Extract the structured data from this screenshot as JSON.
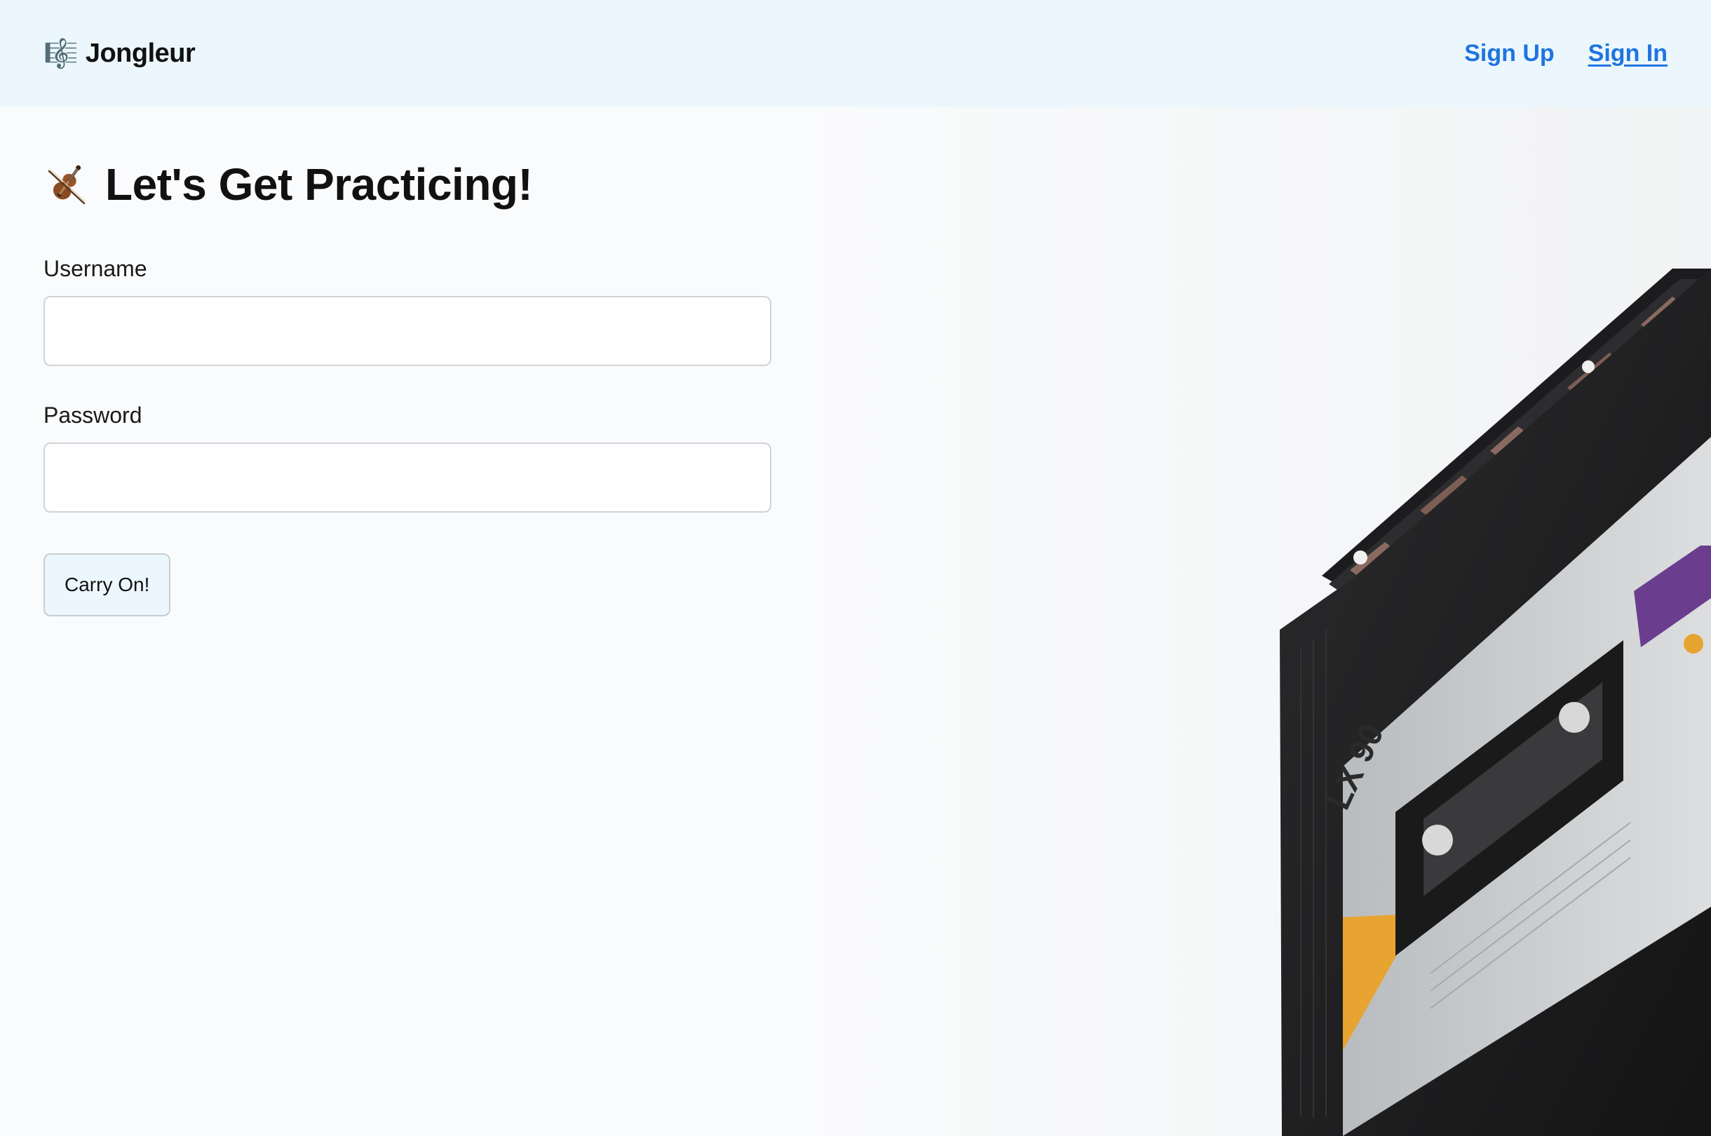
{
  "header": {
    "brand_icon": "🎼",
    "brand_name": "Jongleur",
    "nav": [
      {
        "label": "Sign Up",
        "active": false
      },
      {
        "label": "Sign In",
        "active": true
      }
    ]
  },
  "main": {
    "heading_icon": "violin-icon",
    "heading": "Let's Get Practicing!",
    "username_label": "Username",
    "username_value": "",
    "password_label": "Password",
    "password_value": "",
    "submit_label": "Carry On!"
  },
  "photo": {
    "subject": "cassette-tape",
    "cassette_label": "LX 90"
  },
  "colors": {
    "header_bg": "#ecf7fd",
    "link": "#1f74e0",
    "page_bg": "#fafbfc",
    "button_bg": "#ecf7fd"
  }
}
